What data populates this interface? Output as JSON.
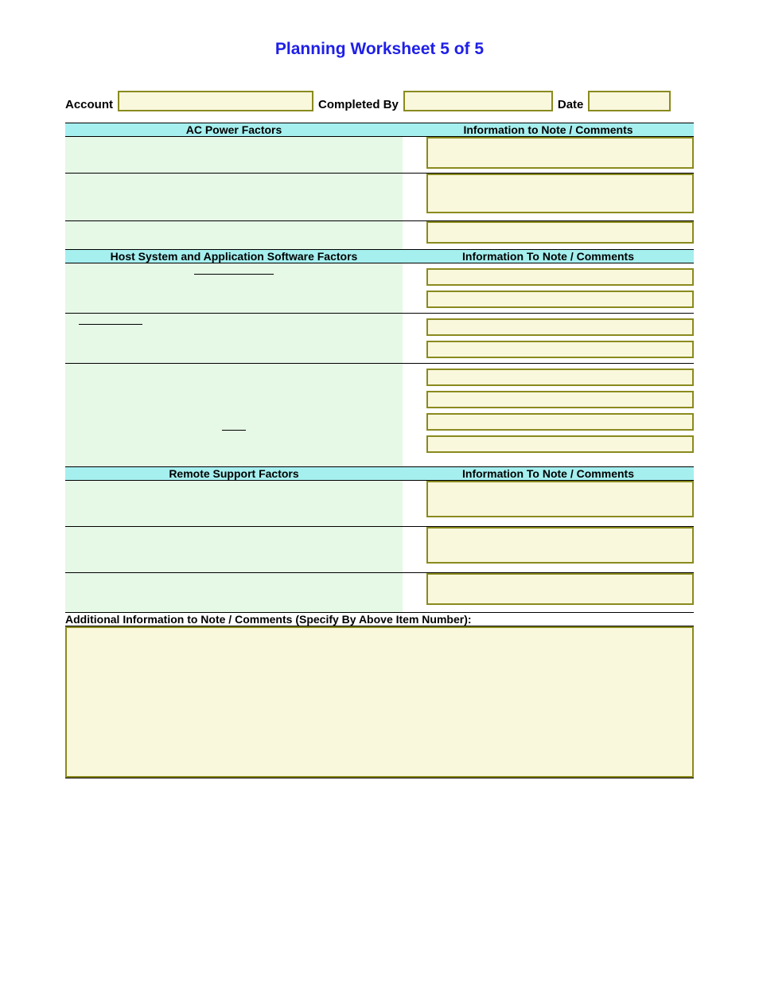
{
  "title": "Planning Worksheet 5 of 5",
  "head": {
    "account_label": "Account",
    "completed_label": "Completed By",
    "date_label": "Date"
  },
  "sections": {
    "s1": {
      "left": "AC Power Factors",
      "right": "Information to Note / Comments"
    },
    "s2": {
      "left": "Host System and Application Software Factors",
      "right": "Information To Note / Comments"
    },
    "s3": {
      "left": "Remote Support Factors",
      "right": "Information To Note / Comments"
    }
  },
  "additional_label": "Additional Information to Note / Comments (Specify By Above Item Number):"
}
